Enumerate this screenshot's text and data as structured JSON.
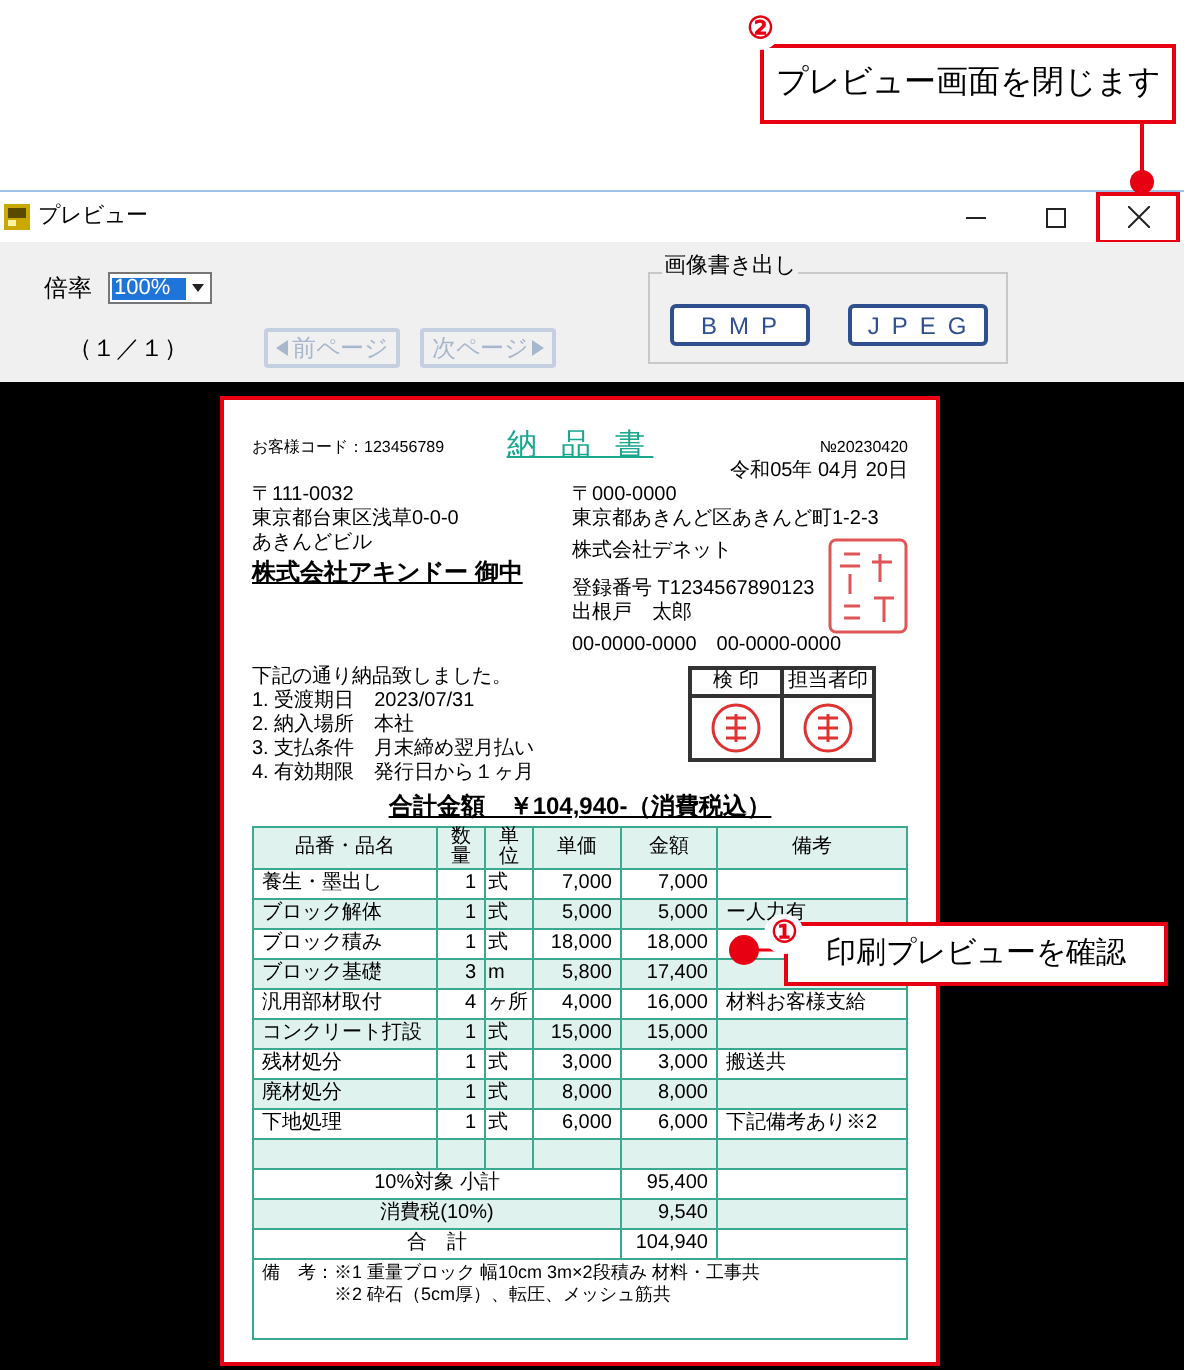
{
  "close_callout": {
    "number": "②",
    "text": "プレビュー画面を閉じます",
    "target_highlighted": true
  },
  "window": {
    "title": "プレビュー"
  },
  "toolbar": {
    "zoom_label": "倍率",
    "zoom_value": "100%",
    "page_indicator": "（１／１）",
    "prev_button": {
      "label": "前ページ",
      "disabled": true
    },
    "next_button": {
      "label": "次ページ",
      "disabled": true
    },
    "export_group": {
      "title": "画像書き出し",
      "buttons": [
        "BMP",
        "JPEG"
      ]
    }
  },
  "document": {
    "customer_code": "お客様コード：123456789",
    "title": "納 品 書",
    "number": "№20230420",
    "date": "令和05年 04月 20日",
    "recipient": {
      "postal": "〒111-0032",
      "address": "東京都台東区浅草0-0-0",
      "building": "あきんどビル",
      "name": "株式会社アキンドー 御中"
    },
    "issuer": {
      "postal": "〒000-0000",
      "address": "東京都あきんど区あきんど町1-2-3",
      "company": "株式会社デネット",
      "registration": "登録番号 T1234567890123",
      "staff": "出根戸　太郎",
      "phone": "00-0000-0000　00-0000-0000"
    },
    "approval_headers": [
      "検 印",
      "担当者印"
    ],
    "intro": "下記の通り納品致しました。",
    "terms": [
      "1. 受渡期日　2023/07/31",
      "2. 納入場所　本社",
      "3. 支払条件　月末締め翌月払い",
      "4. 有効期限　発行日から１ヶ月"
    ],
    "total_line": "合計金額　￥104,940-（消費税込）",
    "table": {
      "columns": [
        "品番・品名",
        "数量",
        "単位",
        "単価",
        "金額",
        "備考"
      ],
      "rows": [
        {
          "kind": "item",
          "name": "養生・墨出し",
          "quantity": "1",
          "unit": "式",
          "price": "7,000",
          "amount": "7,000"
        },
        {
          "kind": "item",
          "name": "ブロック解体",
          "quantity": "1",
          "unit": "式",
          "price": "5,000",
          "amount": "5,000",
          "remarks": "ー人力有"
        },
        {
          "kind": "item",
          "name": "ブロック積み",
          "quantity": "1",
          "unit": "式",
          "price": "18,000",
          "amount": "18,000"
        },
        {
          "kind": "item",
          "name": "ブロック基礎",
          "quantity": "3",
          "unit": "m",
          "price": "5,800",
          "amount": "17,400"
        },
        {
          "kind": "item",
          "name": "汎用部材取付",
          "quantity": "4",
          "unit": "ヶ所",
          "price": "4,000",
          "amount": "16,000",
          "remarks": "材料お客様支給"
        },
        {
          "kind": "item",
          "name": "コンクリート打設",
          "quantity": "1",
          "unit": "式",
          "price": "15,000",
          "amount": "15,000"
        },
        {
          "kind": "item",
          "name": "残材処分",
          "quantity": "1",
          "unit": "式",
          "price": "3,000",
          "amount": "3,000",
          "remarks": "搬送共"
        },
        {
          "kind": "item",
          "name": "廃材処分",
          "quantity": "1",
          "unit": "式",
          "price": "8,000",
          "amount": "8,000"
        },
        {
          "kind": "item",
          "name": "下地処理",
          "quantity": "1",
          "unit": "式",
          "price": "6,000",
          "amount": "6,000",
          "remarks": "下記備考あり※2"
        },
        {
          "kind": "blank"
        }
      ],
      "summary": [
        {
          "label": "10%対象 小計",
          "amount": "95,400"
        },
        {
          "label": "消費税(10%)",
          "amount": "9,540"
        },
        {
          "label": "合　計",
          "amount": "104,940"
        }
      ]
    },
    "notes": [
      "備　考：※1 重量ブロック 幅10cm 3m×2段積み 材料・工事共",
      "※2 砕石（5cm厚）、転圧、メッシュ筋共"
    ]
  },
  "preview_callout": {
    "number": "①",
    "text": "印刷プレビューを確認"
  }
}
